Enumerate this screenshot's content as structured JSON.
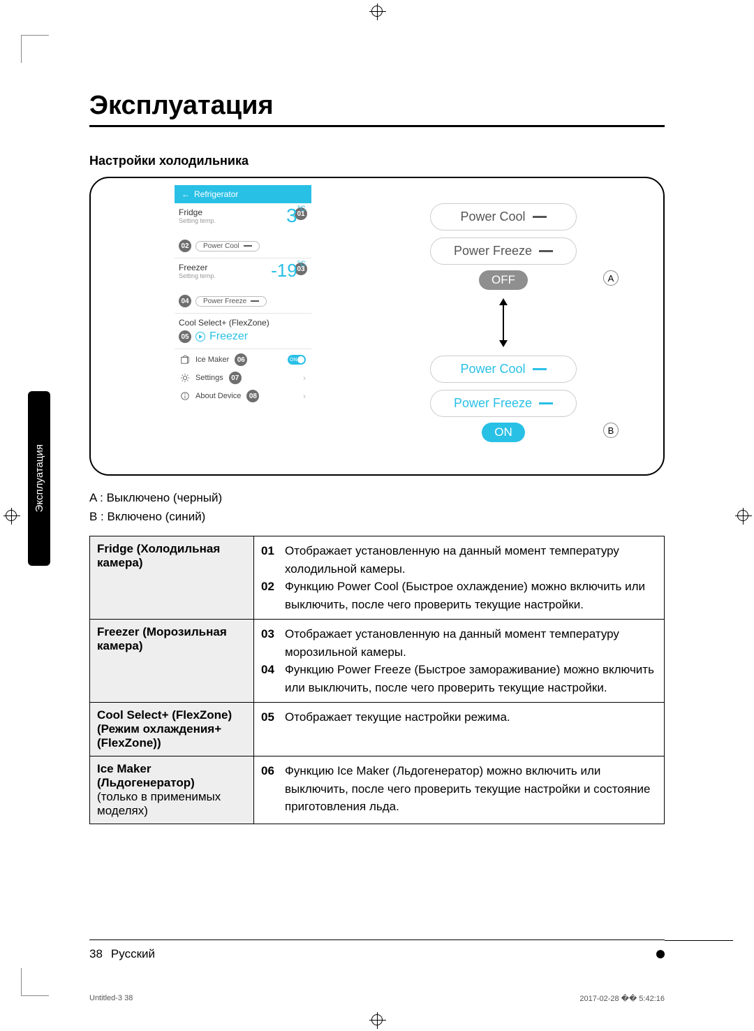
{
  "title": "Эксплуатация",
  "subtitle": "Настройки холодильника",
  "side_tab": "Эксплуатация",
  "phone": {
    "appbar_back": "←",
    "appbar_title": "Refrigerator",
    "fridge_label": "Fridge",
    "setting_temp": "Setting temp.",
    "fridge_temp": "3",
    "unit": "°C",
    "power_cool": "Power Cool",
    "freezer_label": "Freezer",
    "freezer_temp": "-19",
    "power_freeze": "Power Freeze",
    "cool_select": "Cool Select+ (FlexZone)",
    "cs_mode": "Freezer",
    "ice_maker": "Ice Maker",
    "ice_on": "ON",
    "settings": "Settings",
    "about": "About Device"
  },
  "badges": {
    "b01": "01",
    "b02": "02",
    "b03": "03",
    "b04": "04",
    "b05": "05",
    "b06": "06",
    "b07": "07",
    "b08": "08"
  },
  "right": {
    "power_cool": "Power Cool",
    "power_freeze": "Power Freeze",
    "off": "OFF",
    "on": "ON",
    "A": "A",
    "B": "B"
  },
  "legend": {
    "a": "A : Выключено (черный)",
    "b": "B : Включено (синий)"
  },
  "table": {
    "r1_name": "Fridge (Холодильная камера)",
    "r1_01": "Отображает установленную на данный момент температуру холодильной камеры.",
    "r1_02": "Функцию Power Cool (Быстрое охлаждение) можно включить или выключить, после чего проверить текущие настройки.",
    "r2_name": "Freezer (Морозильная камера)",
    "r2_03": "Отображает установленную на данный момент температуру морозильной камеры.",
    "r2_04": "Функцию Power Freeze (Быстрое замораживание) можно включить или выключить, после чего проверить текущие настройки.",
    "r3_name": "Cool Select+ (FlexZone) (Режим охлаждения+ (FlexZone))",
    "r3_05": "Отображает текущие настройки режима.",
    "r4_name_bold": "Ice Maker (Льдогенератор)",
    "r4_name_rest": "(только в применимых моделях)",
    "r4_06": "Функцию Ice Maker (Льдогенератор) можно включить или выключить, после чего проверить текущие настройки и состояние приготовления льда."
  },
  "numbers": {
    "n01": "01",
    "n02": "02",
    "n03": "03",
    "n04": "04",
    "n05": "05",
    "n06": "06"
  },
  "footer": {
    "page": "38",
    "lang": "Русский"
  },
  "imprint": {
    "left": "Untitled-3   38",
    "right": "2017-02-28   �� 5:42:16"
  }
}
